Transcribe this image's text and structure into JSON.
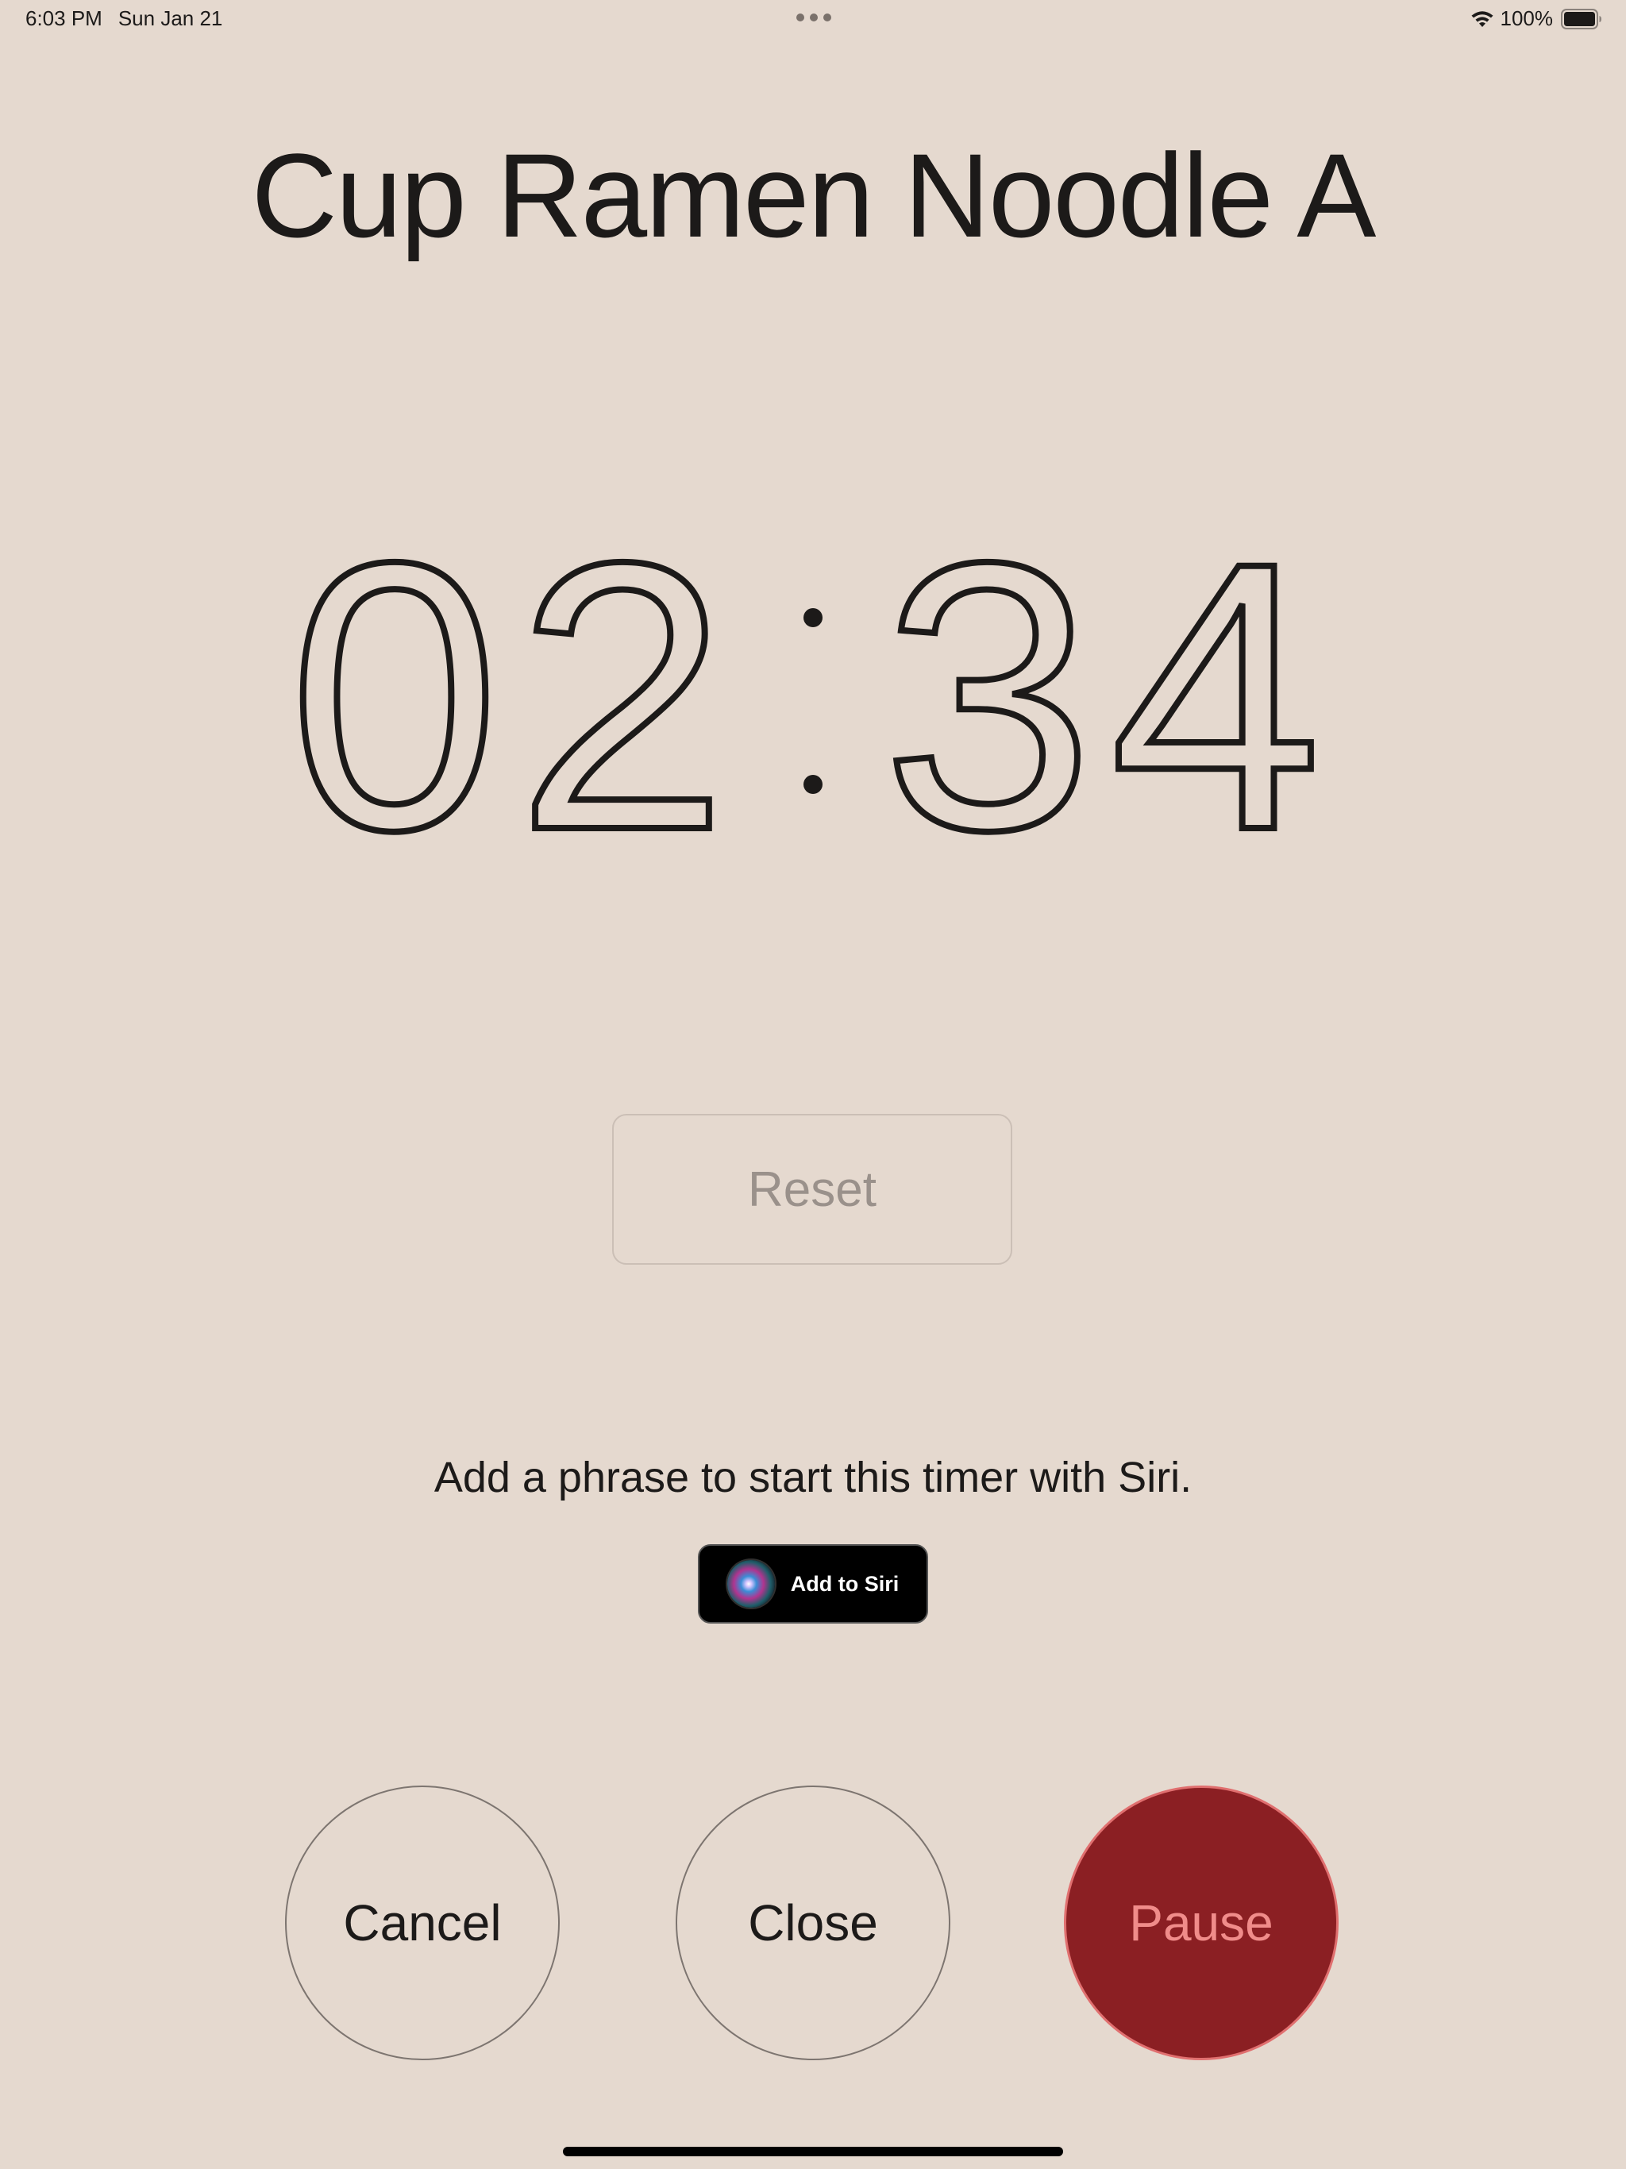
{
  "status_bar": {
    "time": "6:03 PM",
    "date": "Sun Jan 21",
    "battery_percent": "100%",
    "battery_level": 1.0
  },
  "timer": {
    "title": "Cup Ramen Noodle A",
    "minutes": "02",
    "seconds": "34"
  },
  "buttons": {
    "reset": "Reset",
    "cancel": "Cancel",
    "close": "Close",
    "pause": "Pause",
    "add_to_siri": "Add to Siri"
  },
  "siri": {
    "phrase_prompt": "Add a phrase to start this timer with Siri."
  },
  "colors": {
    "background": "#e5d9cf",
    "pause_fill": "#8b1f23",
    "pause_text": "#f08c8a"
  }
}
